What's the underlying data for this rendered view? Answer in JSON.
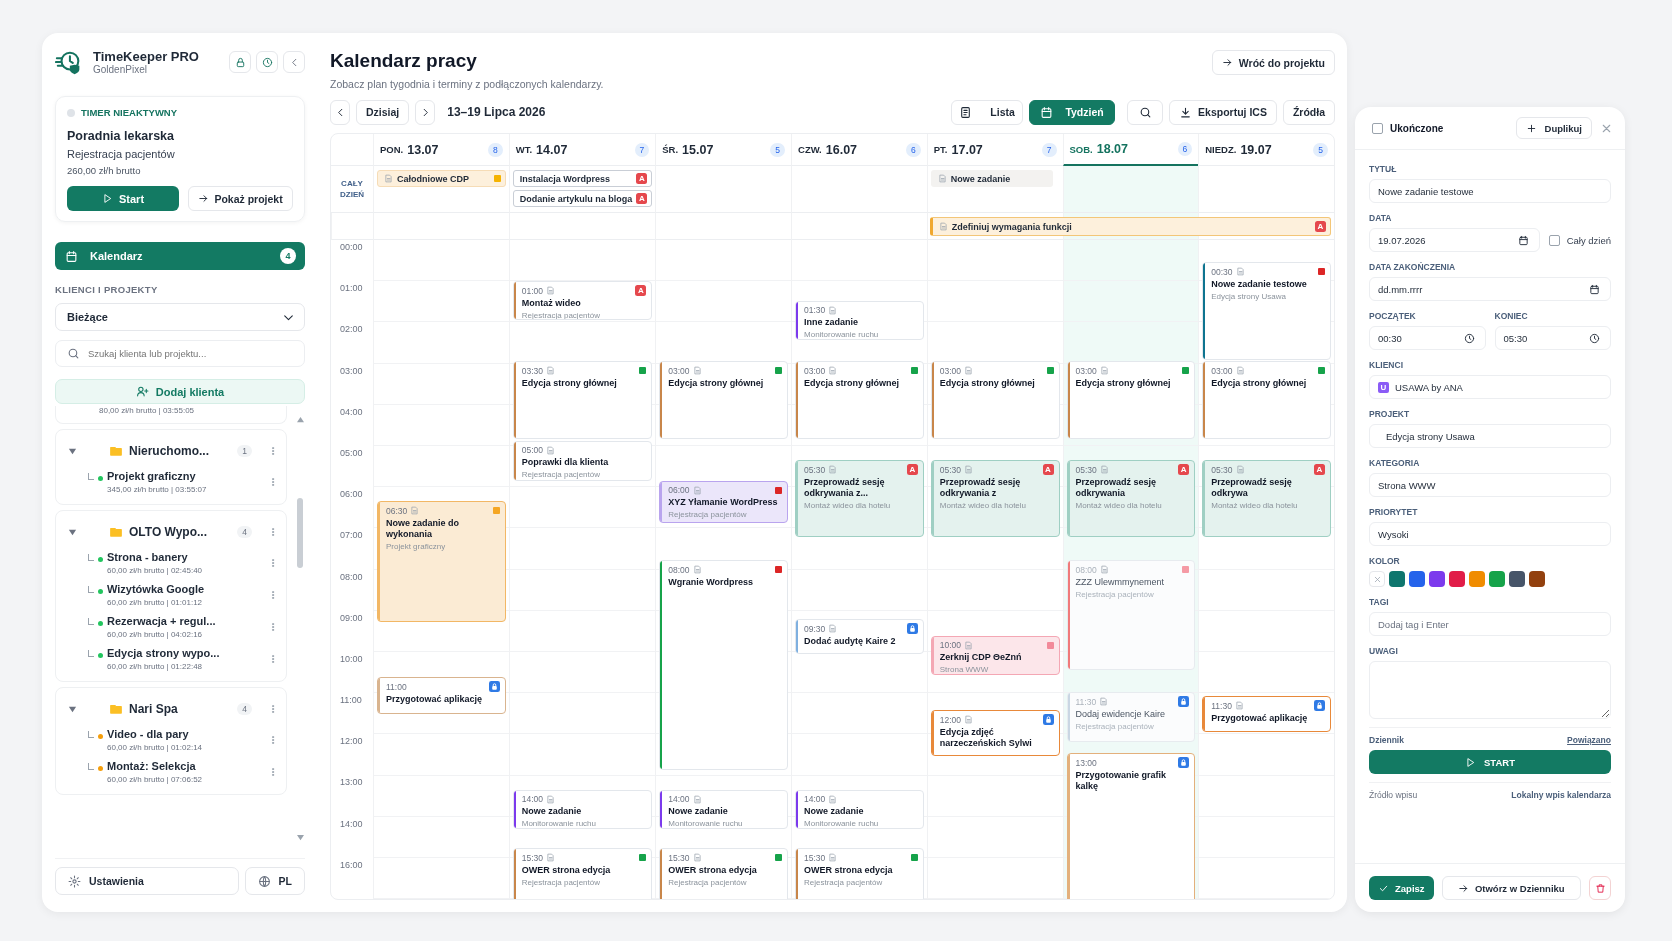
{
  "app": {
    "name": "TimeKeeper PRO",
    "workspace": "GoldenPixel"
  },
  "timer": {
    "active": false,
    "status": "TIMER NIEAKTYWNY",
    "client": "Poradnia lekarska",
    "project": "Rejestracja pacjentów",
    "rate": "260,00 zł/h brutto",
    "start_button": "Start",
    "project_button": "Pokaż projekt"
  },
  "nav": [
    {
      "label": "Kalendarz",
      "count": "4",
      "selected": true
    }
  ],
  "clients_section": {
    "heading": "KLIENCI I PROJEKTY",
    "filter": "Bieżące",
    "search_placeholder": "Szukaj klienta lub projektu...",
    "add_button": "Dodaj klienta"
  },
  "clients": [
    {
      "kind": "cut",
      "meta": "80,00 zł/h brutto | 03:55:05"
    },
    {
      "kind": "group",
      "name": "Nieruchomo...",
      "count": "1",
      "expanded": true,
      "children": [
        {
          "name": "Projekt graficzny",
          "meta": "345,00 zł/h brutto | 03:55:07",
          "color": "#22c55e"
        }
      ]
    },
    {
      "kind": "group",
      "name": "OLTO Wypo...",
      "count": "4",
      "expanded": true,
      "children": [
        {
          "name": "Strona - banery",
          "meta": "60,00 zł/h brutto | 02:45:40",
          "color": "#22c55e"
        },
        {
          "name": "Wizytówka Google",
          "meta": "60,00 zł/h brutto | 01:01:12",
          "color": "#22c55e"
        },
        {
          "name": "Rezerwacja + regul...",
          "meta": "60,00 zł/h brutto | 04:02:16",
          "color": "#22c55e"
        },
        {
          "name": "Edycja strony wypo...",
          "meta": "60,00 zł/h brutto | 01:22:48",
          "color": "#22c55e"
        }
      ]
    },
    {
      "kind": "group",
      "name": "Nari Spa",
      "count": "4",
      "expanded": true,
      "children": [
        {
          "name": "Video - dla pary",
          "meta": "60,00 zł/h brutto | 01:02:14",
          "color": "#f59e0b"
        },
        {
          "name": "Montaż: Selekcja",
          "meta": "60,00 zł/h brutto | 07:06:52",
          "color": "#f59e0b"
        }
      ]
    }
  ],
  "footer": {
    "settings": "Ustawienia",
    "language": "PL"
  },
  "calendar": {
    "title": "Kalendarz pracy",
    "subtitle": "Zobacz plan tygodnia i terminy z podłączonych kalendarzy.",
    "back_button": "Wróć do projektu",
    "today_button": "Dzisiaj",
    "range": "13–19 Lipca 2026",
    "views": [
      {
        "label": "Lista",
        "kind": "list",
        "selected": false
      },
      {
        "label": "Tydzień",
        "kind": "week",
        "selected": true
      }
    ],
    "export_button": "Eksportuj ICS",
    "sources_button": "Źródła",
    "all_day_label": "CAŁY DZIEŃ",
    "hours": [
      "00:00",
      "01:00",
      "02:00",
      "03:00",
      "04:00",
      "05:00",
      "06:00",
      "07:00",
      "08:00",
      "09:00",
      "10:00",
      "11:00",
      "12:00",
      "13:00",
      "14:00",
      "16:00"
    ],
    "span_events": [
      {
        "title": "Zdefiniuj wymagania funkcji",
        "kind": "warm",
        "note": true,
        "flag": {
          "kind": "letter",
          "label": "A"
        }
      }
    ],
    "days": [
      {
        "weekday": "PON.",
        "date": "13.07",
        "count": "8",
        "selected": false,
        "all_day": [
          {
            "title": "Całodniowe CDP",
            "kind": "warm",
            "note": true,
            "flag": {
              "kind": "square",
              "color": "#f5b301"
            }
          }
        ],
        "events": [
          {
            "time": "06:30",
            "note": true,
            "title": "Nowe zadanie do wykonania",
            "subtitle": "Projekt graficzny",
            "color": "#f2b765",
            "kind": "tinted",
            "flag": {
              "kind": "square",
              "color": "#f5a623"
            }
          },
          {
            "time": "11:00",
            "note": false,
            "title": "Przygotować aplikację",
            "color": "#d9b48f",
            "kind": "outlined",
            "flag": {
              "kind": "icon"
            }
          }
        ]
      },
      {
        "weekday": "WT.",
        "date": "14.07",
        "count": "7",
        "selected": false,
        "all_day": [
          {
            "title": "Instalacja Wordpress",
            "kind": "plain",
            "note": false,
            "flag": {
              "kind": "letter",
              "label": "A"
            }
          },
          {
            "title": "Dodanie artykulu na bloga",
            "kind": "plain",
            "note": false,
            "flag": {
              "kind": "letter",
              "label": "A"
            }
          }
        ],
        "events": [
          {
            "time": "01:00",
            "note": true,
            "title": "Montaż wideo",
            "subtitle": "Rejestracja pacjentów",
            "color": "#c8864a",
            "kind": "plain",
            "flag": {
              "kind": "letter",
              "label": "A"
            }
          },
          {
            "time": "03:30",
            "note": true,
            "title": "Edycja strony głównej",
            "color": "#c8864a",
            "kind": "plain",
            "flag": {
              "kind": "square",
              "color": "#16a34a"
            }
          },
          {
            "time": "05:00",
            "note": true,
            "title": "Poprawki dla klienta",
            "subtitle": "Rejestracja pacjentów",
            "color": "#c8864a",
            "kind": "plain"
          },
          {
            "time": "14:00",
            "note": true,
            "title": "Nowe zadanie",
            "subtitle": "Monitorowanie ruchu",
            "color": "#7c3aed",
            "kind": "plain"
          },
          {
            "time": "15:30",
            "note": true,
            "title": "OWER strona edycja",
            "subtitle": "Rejestracja pacjentów",
            "color": "#c8864a",
            "kind": "plain",
            "flag": {
              "kind": "square",
              "color": "#16a34a"
            }
          }
        ]
      },
      {
        "weekday": "ŚR.",
        "date": "15.07",
        "count": "5",
        "selected": false,
        "events": [
          {
            "time": "03:00",
            "note": true,
            "title": "Edycja strony głównej",
            "color": "#c8864a",
            "kind": "plain",
            "flag": {
              "kind": "square",
              "color": "#16a34a"
            }
          },
          {
            "time": "06:00",
            "note": true,
            "title": "XYZ Yłamanie WordPress",
            "subtitle": "Rejestracja pacjentów",
            "color": "#b9a4ee",
            "kind": "tinted",
            "flag": {
              "kind": "square",
              "color": "#dc2626"
            }
          },
          {
            "time": "08:00",
            "note": true,
            "title": "Wgranie Wordpress",
            "color": "#16a34a",
            "kind": "plain",
            "flag": {
              "kind": "square",
              "color": "#dc2626"
            }
          },
          {
            "time": "14:00",
            "note": true,
            "title": "Nowe zadanie",
            "subtitle": "Monitorowanie ruchu",
            "color": "#7c3aed",
            "kind": "plain"
          },
          {
            "time": "15:30",
            "note": true,
            "title": "OWER strona edycja",
            "subtitle": "Rejestracja pacjentów",
            "color": "#c8864a",
            "kind": "plain",
            "flag": {
              "kind": "square",
              "color": "#16a34a"
            }
          }
        ]
      },
      {
        "weekday": "CZW.",
        "date": "16.07",
        "count": "6",
        "selected": false,
        "events": [
          {
            "time": "01:30",
            "note": true,
            "title": "Inne zadanie",
            "subtitle": "Monitorowanie ruchu",
            "color": "#7c3aed",
            "kind": "plain"
          },
          {
            "time": "03:00",
            "note": true,
            "title": "Edycja strony głównej",
            "color": "#c8864a",
            "kind": "plain",
            "flag": {
              "kind": "square",
              "color": "#16a34a"
            }
          },
          {
            "time": "05:30",
            "note": true,
            "title": "Przeprowadź sesję odkrywania z...",
            "subtitle": "Montaż wideo dla hotelu",
            "color": "#9fcfc3",
            "kind": "tinted",
            "flag": {
              "kind": "letter",
              "label": "A"
            }
          },
          {
            "time": "09:30",
            "note": true,
            "title": "Dodać audytę Kaire 2",
            "color": "#7fb0e0",
            "kind": "plain",
            "flag": {
              "kind": "icon"
            }
          },
          {
            "time": "14:00",
            "note": true,
            "title": "Nowe zadanie",
            "subtitle": "Monitorowanie ruchu",
            "color": "#7c3aed",
            "kind": "plain"
          },
          {
            "time": "15:30",
            "note": true,
            "title": "OWER strona edycja",
            "subtitle": "Rejestracja pacjentów",
            "color": "#c8864a",
            "kind": "plain",
            "flag": {
              "kind": "square",
              "color": "#16a34a"
            }
          }
        ]
      },
      {
        "weekday": "PT.",
        "date": "17.07",
        "count": "7",
        "selected": false,
        "all_day": [
          {
            "title": "Nowe zadanie",
            "kind": "muted",
            "note": true
          }
        ],
        "events": [
          {
            "time": "03:00",
            "note": true,
            "title": "Edycja strony głównej",
            "color": "#c8864a",
            "kind": "plain",
            "flag": {
              "kind": "square",
              "color": "#16a34a"
            }
          },
          {
            "time": "05:30",
            "note": true,
            "title": "Przeprowadź sesję odkrywania z",
            "subtitle": "Montaż wideo dla hotelu",
            "color": "#9fcfc3",
            "kind": "tinted",
            "flag": {
              "kind": "letter",
              "label": "A"
            }
          },
          {
            "time": "10:00",
            "note": true,
            "title": "Zerknij CDP ΘeZnń",
            "subtitle": "Strona WWW",
            "color": "#f4a7b4",
            "kind": "tinted",
            "flag": {
              "kind": "square",
              "color": "#f28a9a"
            }
          },
          {
            "time": "12:00",
            "note": true,
            "title": "Edycja zdjęć narzeczeńskich Sylwi",
            "color": "#e8893a",
            "kind": "outlined",
            "flag": {
              "kind": "icon"
            }
          }
        ]
      },
      {
        "weekday": "SOB.",
        "date": "18.07",
        "count": "6",
        "selected": true,
        "events": [
          {
            "time": "03:00",
            "note": true,
            "title": "Edycja strony głównej",
            "color": "#c8864a",
            "kind": "plain",
            "flag": {
              "kind": "square",
              "color": "#16a34a"
            }
          },
          {
            "time": "05:30",
            "note": true,
            "title": "Przeprowadź sesję odkrywania",
            "subtitle": "Montaż wideo dla hotelu",
            "color": "#9fcfc3",
            "kind": "tinted",
            "flag": {
              "kind": "letter",
              "label": "A"
            }
          },
          {
            "time": "08:00",
            "note": true,
            "title": "ZZZ Ulewmmynement",
            "subtitle": "Rejestracja pacjentów",
            "color": "#f07a7a",
            "kind": "faded",
            "flag": {
              "kind": "square",
              "color": "#f59aa5"
            }
          },
          {
            "time": "11:30",
            "note": true,
            "title": "Dodaj ewidencje Kaire",
            "subtitle": "Rejestracja pacjentów",
            "color": "#c9d6e3",
            "kind": "faded",
            "flag": {
              "kind": "icon"
            }
          },
          {
            "time": "13:00",
            "note": false,
            "title": "Przygotowanie grafik kalkę",
            "color": "#e3b07c",
            "kind": "outlined",
            "flag": {
              "kind": "icon"
            }
          }
        ]
      },
      {
        "weekday": "NIEDZ.",
        "date": "19.07",
        "count": "5",
        "selected": false,
        "events": [
          {
            "time": "00:30",
            "note": true,
            "title": "Nowe zadanie testowe",
            "subtitle": "Edycja strony Usawa",
            "color": "#0e7490",
            "kind": "plain",
            "flag": {
              "kind": "square",
              "color": "#dc2626"
            }
          },
          {
            "time": "03:00",
            "note": true,
            "title": "Edycja strony głównej",
            "color": "#c8864a",
            "kind": "plain",
            "flag": {
              "kind": "square",
              "color": "#16a34a"
            }
          },
          {
            "time": "05:30",
            "note": true,
            "title": "Przeprowadź sesję odkrywa",
            "subtitle": "Montaż wideo dla hotelu",
            "color": "#9fcfc3",
            "kind": "tinted",
            "flag": {
              "kind": "letter",
              "label": "A"
            }
          },
          {
            "time": "11:30",
            "note": true,
            "title": "Przygotować aplikację",
            "color": "#e8893a",
            "kind": "outlined",
            "flag": {
              "kind": "icon"
            }
          }
        ]
      }
    ]
  },
  "task_panel": {
    "completed": {
      "label": "Ukończone",
      "checked": false
    },
    "duplicate_button": "Duplikuj",
    "title_field": {
      "label": "TYTUŁ",
      "value": "Nowe zadanie testowe"
    },
    "date_field": {
      "label": "DATA",
      "value": "19.07.2026"
    },
    "all_day": {
      "label": "Cały dzień",
      "checked": false
    },
    "end_date_field": {
      "label": "DATA ZAKOŃCZENIA",
      "value": "dd.mm.rrrr"
    },
    "start_field": {
      "label": "POCZĄTEK",
      "value": "00:30"
    },
    "end_field": {
      "label": "KONIEC",
      "value": "05:30"
    },
    "client_field": {
      "label": "KLIENCI",
      "badge": "U",
      "value": "USAWA by ANA"
    },
    "project_field": {
      "label": "PROJEKT",
      "value": "Edycja strony Usawa"
    },
    "category_field": {
      "label": "KATEGORIA",
      "value": "Strona WWW"
    },
    "priority_field": {
      "label": "PRIORYTET",
      "value": "Wysoki"
    },
    "colors": {
      "label": "KOLOR",
      "swatches": [
        {
          "color": "#0f766e",
          "selected": false
        },
        {
          "color": "#2563eb",
          "selected": false
        },
        {
          "color": "#7c3aed",
          "selected": false
        },
        {
          "color": "#e11d48",
          "selected": false
        },
        {
          "color": "#f08c00",
          "selected": false
        },
        {
          "color": "#16a34a",
          "selected": false
        },
        {
          "color": "#475569",
          "selected": false
        },
        {
          "color": "#92400e",
          "selected": false
        }
      ]
    },
    "tags_field": {
      "label": "TAGI",
      "placeholder": "Dodaj tag i Enter"
    },
    "notes_field": {
      "label": "UWAGI"
    },
    "journal": {
      "label": "Dziennik",
      "value": "Powiązano"
    },
    "start_button": "START",
    "source": {
      "label": "Źródło wpisu",
      "value": "Lokalny wpis kalendarza"
    },
    "save_button": "Zapisz",
    "open_button": "Otwórz w Dzienniku"
  }
}
